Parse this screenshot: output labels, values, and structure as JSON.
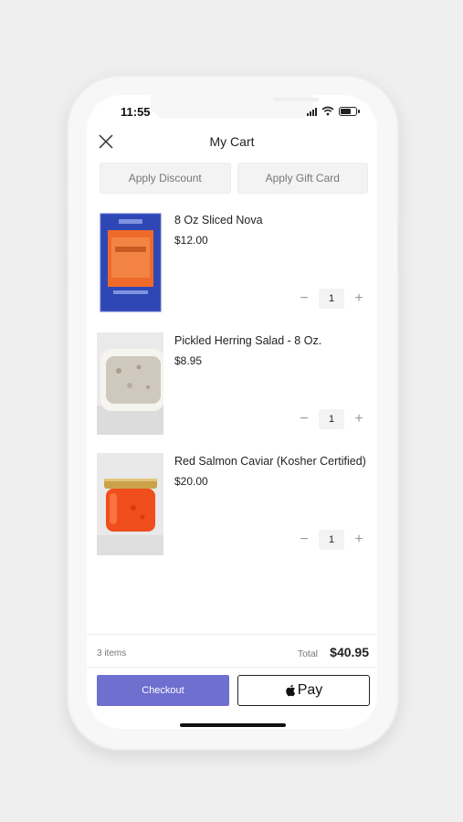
{
  "status_bar": {
    "time": "11:55"
  },
  "header": {
    "title": "My Cart"
  },
  "actions": {
    "discount_label": "Apply Discount",
    "gift_card_label": "Apply Gift Card"
  },
  "items": [
    {
      "name": "8 Oz Sliced Nova",
      "price": "$12.00",
      "quantity": "1"
    },
    {
      "name": "Pickled Herring Salad - 8 Oz.",
      "price": "$8.95",
      "quantity": "1"
    },
    {
      "name": "Red Salmon Caviar (Kosher Certified)",
      "price": "$20.00",
      "quantity": "1"
    }
  ],
  "summary": {
    "items_count": "3 items",
    "total_label": "Total",
    "total_value": "$40.95"
  },
  "checkout": {
    "checkout_label": "Checkout",
    "applepay_label": "Pay"
  },
  "colors": {
    "accent": "#6e6fcf"
  }
}
